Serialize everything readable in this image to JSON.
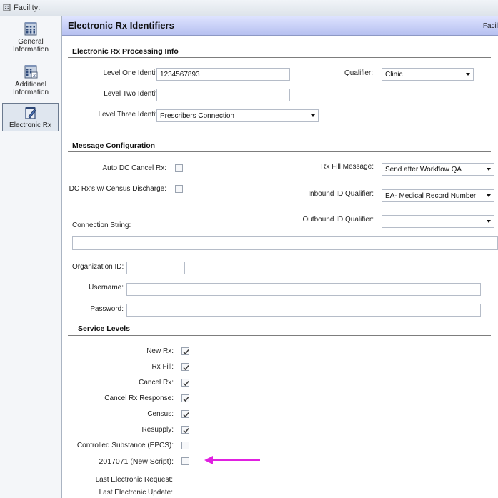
{
  "window": {
    "title": "Facility:"
  },
  "nav": {
    "items": [
      {
        "label_line1": "General",
        "label_line2": "Information"
      },
      {
        "label_line1": "Additional",
        "label_line2": "Information"
      },
      {
        "label_line1": "Electronic Rx",
        "label_line2": ""
      }
    ],
    "selected": "Electronic Rx"
  },
  "header": {
    "title": "Electronic Rx Identifiers",
    "right_text": "Facil"
  },
  "processing": {
    "section_title": "Electronic Rx Processing Info",
    "level_one_label": "Level One Identifier:",
    "level_one_value": "1234567893",
    "level_two_label": "Level Two Identifier:",
    "level_two_value": "",
    "level_three_label": "Level Three Identifier:",
    "level_three_value": "Prescribers Connection",
    "qualifier_label": "Qualifier:",
    "qualifier_value": "Clinic"
  },
  "message": {
    "section_title": "Message Configuration",
    "auto_dc_label": "Auto DC Cancel Rx:",
    "auto_dc_checked": false,
    "dc_census_label": "DC Rx's w/ Census Discharge:",
    "dc_census_checked": false,
    "fill_message_label": "Rx Fill Message:",
    "fill_message_value": "Send after Workflow QA",
    "inbound_label": "Inbound ID Qualifier:",
    "inbound_value": "EA- Medical Record Number",
    "outbound_label": "Outbound ID Qualifier:",
    "outbound_value": "",
    "connection_label": "Connection String:",
    "connection_value": "",
    "org_label": "Organization ID:",
    "org_value": "",
    "username_label": "Username:",
    "username_value": "",
    "password_label": "Password:",
    "password_value": ""
  },
  "service": {
    "section_title": "Service Levels",
    "items": [
      {
        "label": "New Rx:",
        "checked": true
      },
      {
        "label": "Rx Fill:",
        "checked": true
      },
      {
        "label": "Cancel Rx:",
        "checked": true
      },
      {
        "label": "Cancel Rx Response:",
        "checked": true
      },
      {
        "label": "Census:",
        "checked": true
      },
      {
        "label": "Resupply:",
        "checked": true
      },
      {
        "label": "Controlled Substance (EPCS):",
        "checked": false
      },
      {
        "label": "2017071 (New Script):",
        "checked": false
      }
    ],
    "last_request_label": "Last Electronic Request:",
    "last_update_label": "Last Electronic Update:"
  },
  "colors": {
    "header_bg": "#c9d0f8",
    "arrow": "#e020e0",
    "check": "#3a3a3a"
  }
}
